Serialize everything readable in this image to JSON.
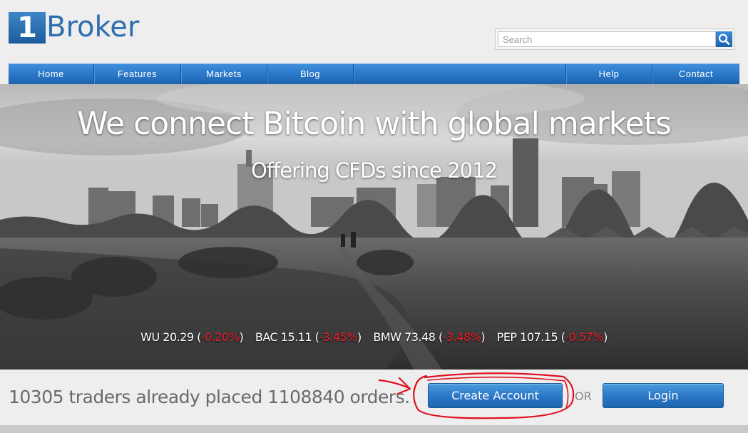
{
  "brand": {
    "logo_number": "1",
    "logo_word": "Broker"
  },
  "search": {
    "placeholder": "Search",
    "icon": "search-icon"
  },
  "nav": {
    "items": [
      "Home",
      "Features",
      "Markets",
      "Blog",
      "Help",
      "Contact"
    ]
  },
  "hero": {
    "title": "We connect Bitcoin with global markets",
    "subtitle": "Offering CFDs since 2012",
    "tickers": [
      {
        "symbol": "WU",
        "price": "20.29",
        "change": "-0.20%"
      },
      {
        "symbol": "BAC",
        "price": "15.11",
        "change": "-3.45%"
      },
      {
        "symbol": "BMW",
        "price": "73.48",
        "change": "-3.48%"
      },
      {
        "symbol": "PEP",
        "price": "107.15",
        "change": "-0.57%"
      }
    ]
  },
  "cta": {
    "stats_text": "10305 traders already placed 1108840 orders.",
    "create_account_label": "Create Account",
    "or_label": "OR",
    "login_label": "Login"
  },
  "colors": {
    "brand_blue": "#2e6eb0",
    "nav_blue": "#2a78c8",
    "ticker_negative": "#e8202a",
    "annotation_red": "#e01020"
  }
}
